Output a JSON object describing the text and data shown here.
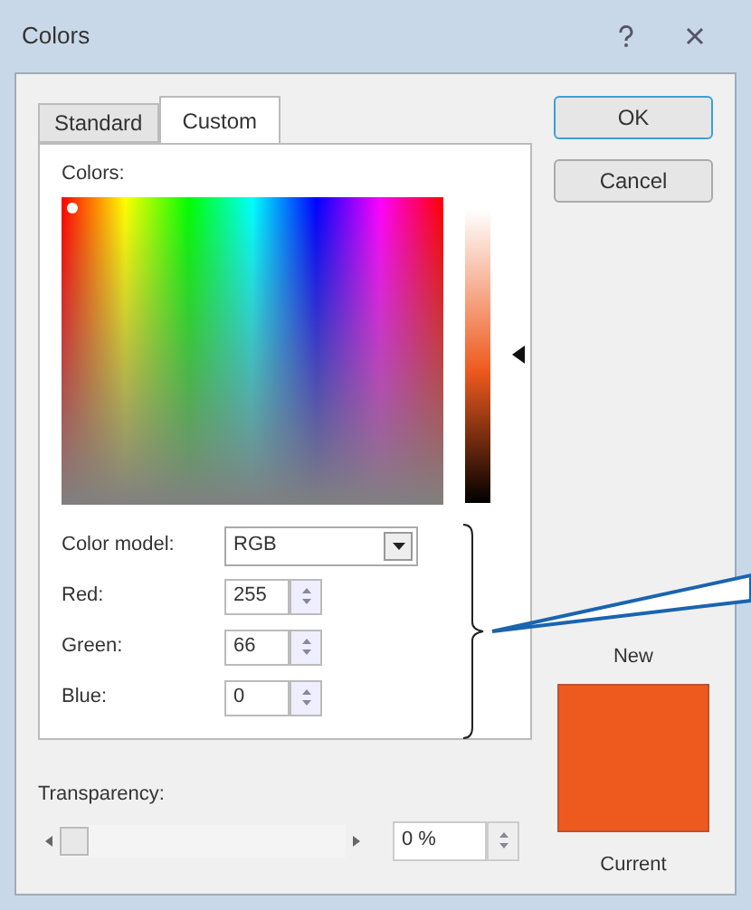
{
  "window": {
    "title": "Colors"
  },
  "tabs": [
    {
      "label": "Standard",
      "selected": false
    },
    {
      "label": "Custom",
      "selected": true
    }
  ],
  "colors_label": "Colors:",
  "fields": [
    {
      "kind": "dropdown",
      "label": "Color model:",
      "value": "RGB"
    },
    {
      "kind": "spinner",
      "label": "Red:",
      "value": "255"
    },
    {
      "kind": "spinner",
      "label": "Green:",
      "value": "66"
    },
    {
      "kind": "spinner",
      "label": "Blue:",
      "value": "0"
    }
  ],
  "transparency": {
    "label": "Transparency:",
    "level": 0,
    "value": "0 %"
  },
  "buttons": [
    "OK",
    "Cancel"
  ],
  "preview": {
    "new_label": "New",
    "current_label": "Current",
    "color": "#ee5a1e"
  }
}
